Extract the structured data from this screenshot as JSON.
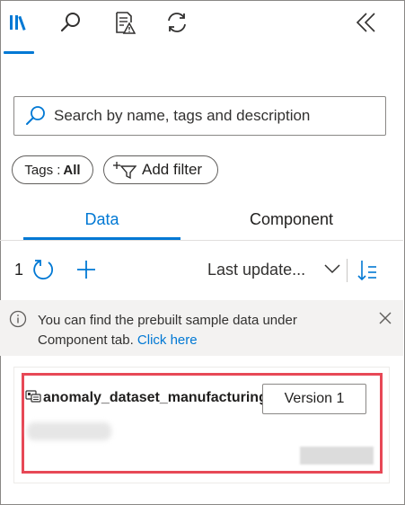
{
  "toolbar": {
    "icons": [
      "library-icon",
      "search-icon",
      "document-alert-icon",
      "refresh-sync-icon",
      "collapse-double-chevron-icon"
    ],
    "accent_color": "#0078d4"
  },
  "search": {
    "placeholder": "Search by name, tags and description",
    "value": ""
  },
  "filters": {
    "tags_label": "Tags :",
    "tags_value": "All",
    "add_filter_label": "Add filter"
  },
  "tabs": {
    "items": [
      "Data",
      "Component"
    ],
    "active": "Data"
  },
  "commands": {
    "count": "1",
    "sort_label": "Last update..."
  },
  "info_bar": {
    "message": "You can find the prebuilt sample data under Component tab.",
    "link_text": "Click here"
  },
  "card": {
    "title": "anomaly_dataset_manufacturing",
    "version_label": "Version 1",
    "highlight_color": "#e74856"
  }
}
